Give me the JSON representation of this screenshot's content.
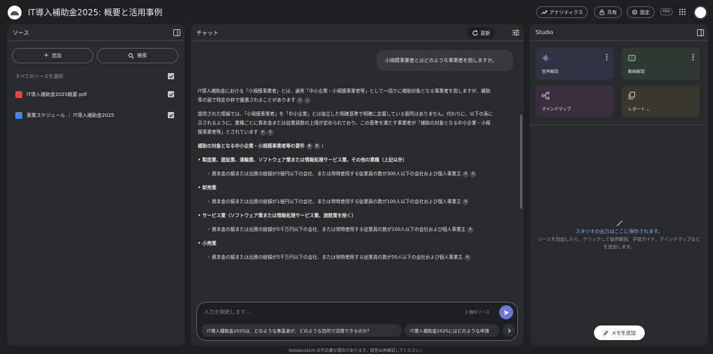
{
  "header": {
    "title": "IT導入補助金2025: 概要と活用事例",
    "analytics_label": "アナリティクス",
    "share_label": "共有",
    "settings_label": "設定",
    "pro_badge": "PRO"
  },
  "sources": {
    "title": "ソース",
    "add_label": "追加",
    "search_label": "検索",
    "select_all": "すべてのソースを選択",
    "items": [
      {
        "label": "IT導入補助金2025概要.pdf",
        "icon": "pdf-icon",
        "color": "#e8453c"
      },
      {
        "label": "事業スケジュール ｜ IT導入補助金2025",
        "icon": "web-icon",
        "color": "#4285f4"
      }
    ]
  },
  "chat": {
    "title": "チャット",
    "refresh_label": "更新",
    "user_message": "小規模事業者とはどのような事業者を指しますか。",
    "answer": {
      "p1": "IT導入補助金における「小規模事業者」とは、通常「中小企業・小規模事業者等」として一括りに補助対象となる事業者を指しますが、補助率の面で特定の枠で優遇されることがあります",
      "p1_cites": [
        "1",
        "..."
      ],
      "p2": "提供された情報では、「小規模事業者」を「中小企業」とは独立した明確基準で明確に定義している箇所はありません。代わりに、以下の表に示されるように、業種ごとに資本金または従業員数の上限が定められており、この基準を満たす事業者が「補助の対象となる中小企業・小規模事業者等」とされています",
      "p2_cites": [
        "4",
        "5"
      ],
      "heading": "補助の対象となる中小企業・小規模事業者等の要件",
      "heading_cites": [
        "4",
        "5"
      ],
      "items": [
        {
          "industry": "• 製造業、建設業、運輸業、ソフトウェア業または情報処理サービス業、その他の業種（上記以外）",
          "detail": "◦ 資本金の額または出資の総額が3億円以下の会社、または常時使用する従業員の数が300人以下の会社および個人事業主",
          "cites": [
            "4",
            "5"
          ]
        },
        {
          "industry": "• 卸売業",
          "detail": "◦ 資本金の額または出資の総額が1億円以下の会社、または常時使用する従業員の数が100人以下の会社および個人事業主",
          "cites": [
            "4"
          ]
        },
        {
          "industry": "• サービス業（ソフトウェア業または情報処理サービス業、旅館業を除く）",
          "detail": "◦ 資本金の額または出資の総額が5千万円以下の会社、または常時使用する従業員の数が100人以下の会社および個人事業主",
          "cites": [
            "4"
          ]
        },
        {
          "industry": "• 小売業",
          "detail": "◦ 資本金の額または出資の総額が5千万円以下の会社、または常時使用する従業員の数が50人以下の会社および個人事業主",
          "cites": [
            "4"
          ]
        }
      ]
    },
    "input_placeholder": "入力を開始します...",
    "source_count": "2 個のソース",
    "suggestions": [
      "IT導入補助金2025は、どのような事業者が、どのような目的で活用できるのか？",
      "IT導入補助金2025にはどのような申請"
    ]
  },
  "studio": {
    "title": "Studio",
    "cards": [
      {
        "label": "音声解説",
        "icon": "audio-waveform-icon",
        "bg": "#2f3342",
        "accent": "#a8b4f0"
      },
      {
        "label": "動画解説",
        "icon": "video-icon",
        "bg": "#2e3a32",
        "accent": "#9fd6a8"
      },
      {
        "label": "マインドマップ",
        "icon": "mindmap-icon",
        "bg": "#3a2f3c",
        "accent": "#e0a0e6"
      },
      {
        "label": "レポート",
        "icon": "report-icon",
        "bg": "#38382e",
        "accent": "#d8d4a0"
      }
    ],
    "empty_title": "スタジオの出力はここに保存されます。",
    "empty_desc": "ソースを追加したら、クリックして音声解説、学習ガイド、マインドマップなどを追加します。",
    "memo_label": "メモを追加"
  },
  "footer": "NotebookLM は不正確な場合があります。回答は再確認してください。"
}
